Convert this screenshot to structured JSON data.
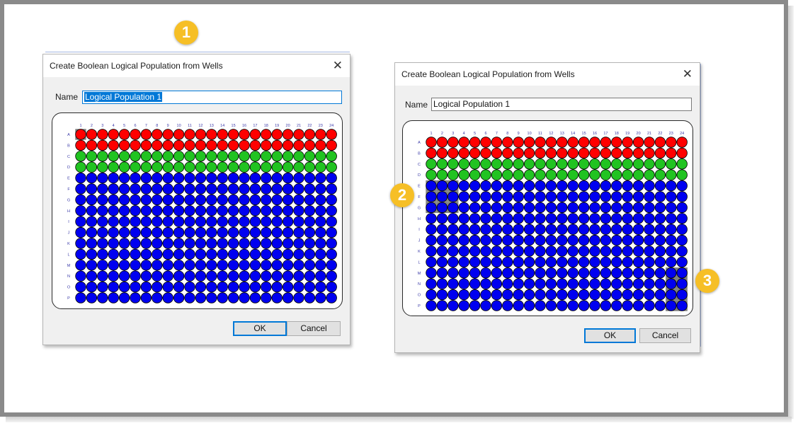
{
  "dialogs": [
    {
      "title": "Create Boolean Logical Population from Wells",
      "name_label": "Name",
      "name_value": "Logical Population 1",
      "ok_label": "OK",
      "cancel_label": "Cancel",
      "selected_wells": [
        "A1"
      ]
    },
    {
      "title": "Create Boolean Logical Population from Wells",
      "name_label": "Name",
      "name_value": "Logical Population 1",
      "ok_label": "OK",
      "cancel_label": "Cancel",
      "selected_wells": [
        "E1",
        "E2",
        "E3",
        "F1",
        "F2",
        "F3",
        "G1",
        "G2",
        "G3",
        "M23",
        "M24",
        "N23",
        "N24",
        "O23",
        "O24",
        "P23",
        "P24"
      ]
    }
  ],
  "plate": {
    "columns": [
      "1",
      "2",
      "3",
      "4",
      "5",
      "6",
      "7",
      "8",
      "9",
      "10",
      "11",
      "12",
      "13",
      "14",
      "15",
      "16",
      "17",
      "18",
      "19",
      "20",
      "21",
      "22",
      "23",
      "24"
    ],
    "rows": [
      "A",
      "B",
      "C",
      "D",
      "E",
      "F",
      "G",
      "H",
      "I",
      "J",
      "K",
      "L",
      "M",
      "N",
      "O",
      "P"
    ],
    "row_colors": {
      "A": "red",
      "B": "red",
      "C": "green",
      "D": "green",
      "E": "blue",
      "F": "blue",
      "G": "blue",
      "H": "blue",
      "I": "blue",
      "J": "blue",
      "K": "blue",
      "L": "blue",
      "M": "blue",
      "N": "blue",
      "O": "blue",
      "P": "blue"
    },
    "colors": {
      "red": "#ff0000",
      "green": "#21c321",
      "blue": "#0000f0",
      "well_outline": "#000000",
      "label": "#3a3aa8",
      "selection": "#808080"
    }
  },
  "callouts": [
    "1",
    "2",
    "3"
  ],
  "colors": {
    "callout": "#f6bf26",
    "accent": "#0078d7"
  }
}
